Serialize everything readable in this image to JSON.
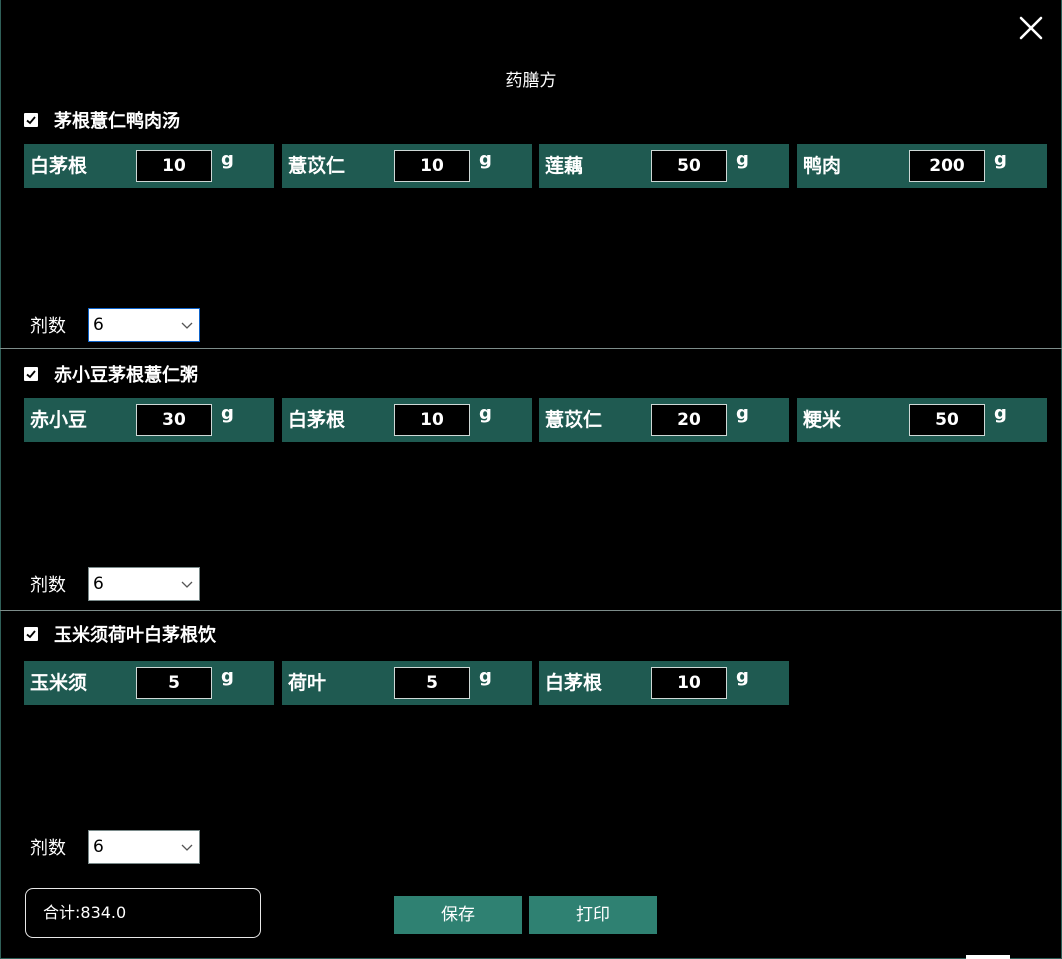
{
  "window": {
    "title": "药膳方",
    "close_icon": "close-icon"
  },
  "sections": [
    {
      "name": "茅根薏仁鸭肉汤",
      "checked": true,
      "ingredients": [
        {
          "name": "白茅根",
          "amount": "10",
          "unit": "g"
        },
        {
          "name": "薏苡仁",
          "amount": "10",
          "unit": "g"
        },
        {
          "name": "莲藕",
          "amount": "50",
          "unit": "g"
        },
        {
          "name": "鸭肉",
          "amount": "200",
          "unit": "g"
        }
      ],
      "dose_label": "剂数",
      "dose_value": "6"
    },
    {
      "name": "赤小豆茅根薏仁粥",
      "checked": true,
      "ingredients": [
        {
          "name": "赤小豆",
          "amount": "30",
          "unit": "g"
        },
        {
          "name": "白茅根",
          "amount": "10",
          "unit": "g"
        },
        {
          "name": "薏苡仁",
          "amount": "20",
          "unit": "g"
        },
        {
          "name": "粳米",
          "amount": "50",
          "unit": "g"
        }
      ],
      "dose_label": "剂数",
      "dose_value": "6"
    },
    {
      "name": "玉米须荷叶白茅根饮",
      "checked": true,
      "ingredients": [
        {
          "name": "玉米须",
          "amount": "5",
          "unit": "g"
        },
        {
          "name": "荷叶",
          "amount": "5",
          "unit": "g"
        },
        {
          "name": "白茅根",
          "amount": "10",
          "unit": "g"
        }
      ],
      "dose_label": "剂数",
      "dose_value": "6"
    }
  ],
  "footer": {
    "total_text": "合计:834.0",
    "save_label": "保存",
    "print_label": "打印"
  },
  "colors": {
    "background": "#000000",
    "ingredient_bg": "#1f5a51",
    "button_bg": "#2f8172",
    "text": "#ffffff"
  }
}
